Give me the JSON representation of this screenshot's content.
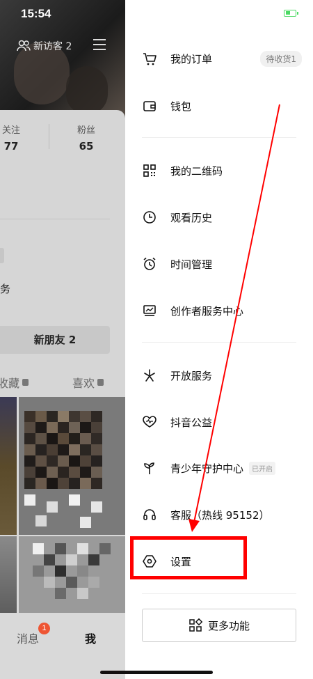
{
  "status_bar": {
    "time": "15:54"
  },
  "profile": {
    "new_visitors": "新访客 2",
    "stats": {
      "following_label": "关注",
      "following_count": "77",
      "fans_label": "粉丝",
      "fans_count": "65"
    },
    "fragment_text": "务",
    "new_friends": "新朋友 2",
    "tabs": {
      "collect": "收藏",
      "likes": "喜欢"
    },
    "bottom_nav": {
      "messages": "消息",
      "messages_badge": "1",
      "me": "我"
    }
  },
  "drawer": {
    "items": [
      {
        "label": "我的订单",
        "tag": "待收货1",
        "icon": "cart-icon"
      },
      {
        "label": "钱包",
        "icon": "wallet-icon"
      },
      {
        "label": "我的二维码",
        "icon": "qrcode-icon"
      },
      {
        "label": "观看历史",
        "icon": "clock-icon"
      },
      {
        "label": "时间管理",
        "icon": "alarm-icon"
      },
      {
        "label": "创作者服务中心",
        "icon": "creator-icon"
      },
      {
        "label": "开放服务",
        "icon": "open-service-icon"
      },
      {
        "label": "抖音公益",
        "icon": "charity-icon"
      },
      {
        "label": "青少年守护中心",
        "tag": "已开启",
        "icon": "sprout-icon"
      },
      {
        "label": "客服（热线 95152）",
        "icon": "headset-icon"
      },
      {
        "label": "设置",
        "icon": "settings-icon"
      }
    ],
    "more_button": "更多功能"
  },
  "colors": {
    "annotation": "#ff0000",
    "battery": "#4cd964",
    "badge": "#ee5533"
  }
}
